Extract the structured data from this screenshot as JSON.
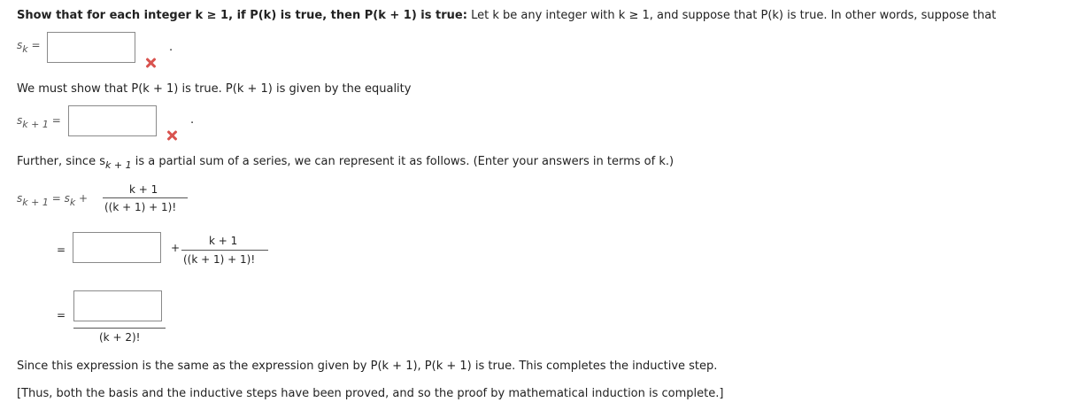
{
  "header": {
    "title": "Show that for each integer k ≥ 1, if P(k) is true, then P(k + 1) is true:",
    "intro": "Let k be any integer with k ≥ 1, and suppose that P(k) is true. In other words, suppose that"
  },
  "eq1": {
    "lhs_s": "s",
    "lhs_sub": "k",
    "eq": "=",
    "period": ".",
    "value": ""
  },
  "line2": "We must show that P(k + 1) is true. P(k + 1) is given by the equality",
  "eq2": {
    "lhs_s": "s",
    "lhs_sub": "k + 1",
    "eq": "=",
    "period": ".",
    "value": ""
  },
  "line3a": "Further, since s",
  "line3sub": "k + 1",
  "line3b": "is a partial sum of a series, we can represent it as follows. (Enter your answers in terms of k.)",
  "eq3": {
    "lhs_s": "s",
    "lhs_sub": "k + 1",
    "eq": "=",
    "rhs_s": "s",
    "rhs_sub": "k",
    "plus": "+",
    "num": "k + 1",
    "den": "((k + 1) + 1)!"
  },
  "eq4": {
    "eq": "=",
    "plus": "+",
    "num": "k + 1",
    "den": "((k + 1) + 1)!",
    "value": ""
  },
  "eq5": {
    "eq": "=",
    "den": "(k + 2)!",
    "value": ""
  },
  "line4": "Since this expression is the same as the expression given by P(k + 1), P(k + 1) is true. This completes the inductive step.",
  "line5": "[Thus, both the basis and the inductive steps have been proved, and so the proof by mathematical induction is complete.]",
  "colors": {
    "error": "#d9534f",
    "border": "#8a8a8a"
  }
}
